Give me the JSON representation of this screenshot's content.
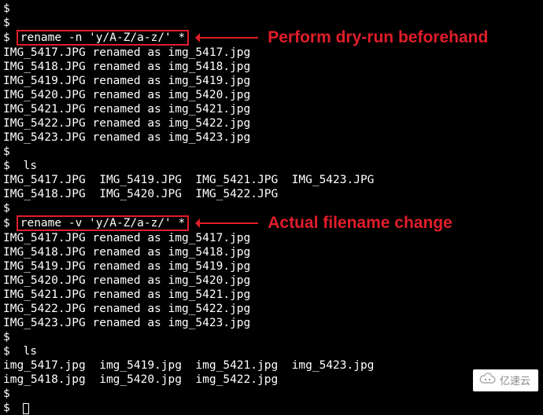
{
  "ps1": "$",
  "cmd1": "rename -n 'y/A-Z/a-z/' *",
  "callout1": "Perform dry-run beforehand",
  "rename_out1": [
    "IMG_5417.JPG renamed as img_5417.jpg",
    "IMG_5418.JPG renamed as img_5418.jpg",
    "IMG_5419.JPG renamed as img_5419.jpg",
    "IMG_5420.JPG renamed as img_5420.jpg",
    "IMG_5421.JPG renamed as img_5421.jpg",
    "IMG_5422.JPG renamed as img_5422.jpg",
    "IMG_5423.JPG renamed as img_5423.jpg"
  ],
  "ls_cmd": "ls",
  "ls1": [
    "IMG_5417.JPG  IMG_5419.JPG  IMG_5421.JPG  IMG_5423.JPG",
    "IMG_5418.JPG  IMG_5420.JPG  IMG_5422.JPG"
  ],
  "cmd2": "rename -v 'y/A-Z/a-z/' *",
  "callout2": "Actual filename change",
  "rename_out2": [
    "IMG_5417.JPG renamed as img_5417.jpg",
    "IMG_5418.JPG renamed as img_5418.jpg",
    "IMG_5419.JPG renamed as img_5419.jpg",
    "IMG_5420.JPG renamed as img_5420.jpg",
    "IMG_5421.JPG renamed as img_5421.jpg",
    "IMG_5422.JPG renamed as img_5422.jpg",
    "IMG_5423.JPG renamed as img_5423.jpg"
  ],
  "ls2": [
    "img_5417.jpg  img_5419.jpg  img_5421.jpg  img_5423.jpg",
    "img_5418.jpg  img_5420.jpg  img_5422.jpg"
  ],
  "watermark": "亿速云"
}
